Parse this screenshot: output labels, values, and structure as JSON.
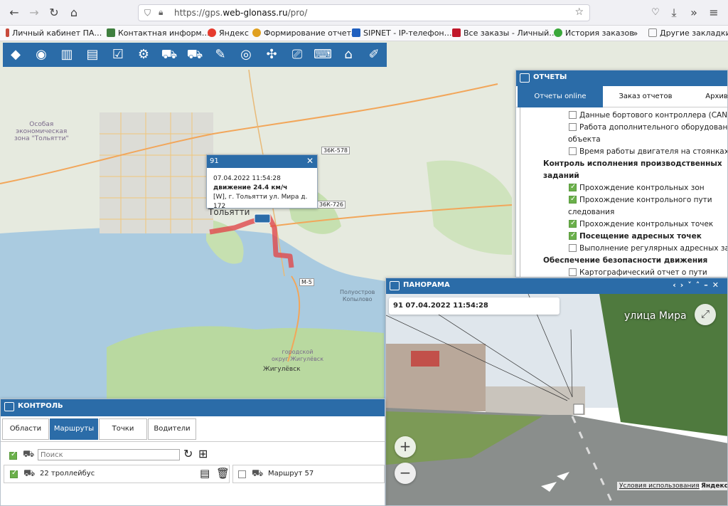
{
  "browser": {
    "url_prefix": "https://gps.",
    "url_domain": "web-glonass.ru",
    "url_path": "/pro/",
    "bookmarks": [
      {
        "label": "Личный кабинет ПА…",
        "color": "#c84b3c"
      },
      {
        "label": "Контактная информ…",
        "color": "#3f7f3f"
      },
      {
        "label": "Яндекс",
        "color": "#e63b2e"
      },
      {
        "label": "Формирование отчета",
        "color": "#e0a020"
      },
      {
        "label": "SIPNET - IP-телефон…",
        "color": "#1f5fbf"
      },
      {
        "label": "Все заказы - Личный…",
        "color": "#c0182a"
      },
      {
        "label": "История заказов",
        "color": "#3aa83a"
      },
      {
        "label": "Другие закладки",
        "color": "#888888"
      }
    ]
  },
  "map": {
    "labels": {
      "zone": [
        "Особая",
        "экономическая",
        "зона \"Тольятти\""
      ],
      "city": "Тольятти",
      "road1": "36К-578",
      "road2": "36К-726",
      "road3": "М-5",
      "village": [
        "Полуостров",
        "Копылово"
      ],
      "district": [
        "городской",
        "округ Жигулёвск"
      ],
      "town": "Жигулёвск"
    }
  },
  "popup": {
    "title": "91",
    "datetime": "07.04.2022 11:54:28",
    "status": "движение 24.4 км/ч",
    "address": "[W], г. Тольятти ул. Мира д. 172"
  },
  "reports": {
    "title": "ОТЧЕТЫ",
    "tabs": [
      "Отчеты online",
      "Заказ отчетов",
      "Архив"
    ],
    "items": [
      {
        "label": "Данные бортового контроллера (CAN)",
        "checked": false
      },
      {
        "label": "Работа дополнительного оборудования",
        "checked": false
      },
      {
        "label": "объекта",
        "continuation": true
      },
      {
        "label": "Время работы двигателя на стоянках",
        "checked": false
      },
      {
        "label": "Контроль исполнения производственных",
        "heading": true
      },
      {
        "label": "заданий",
        "heading": true
      },
      {
        "label": "Прохождение контрольных зон",
        "checked": true
      },
      {
        "label": "Прохождение контрольного пути",
        "checked": true
      },
      {
        "label": "следования",
        "continuation": true
      },
      {
        "label": "Прохождение контрольных точек",
        "checked": true
      },
      {
        "label": "Посещение адресных точек",
        "checked": true,
        "bold": true
      },
      {
        "label": "Выполнение регулярных адресных зад",
        "checked": false
      },
      {
        "label": "Обеспечение безопасности движения",
        "heading": true
      },
      {
        "label": "Картографический отчет о пути",
        "checked": false
      }
    ]
  },
  "panorama": {
    "title": "ПАНОРАМА",
    "caption": "91 07.04.2022 11:54:28",
    "street": "улица Мира",
    "terms": "Условия использования",
    "brand": "Яндекс"
  },
  "control": {
    "title": "КОНТРОЛЬ",
    "tabs": [
      "Области",
      "Маршруты",
      "Точки",
      "Водители"
    ],
    "search_placeholder": "Поиск",
    "routes": [
      "22 троллейбус",
      "Маршрут 57"
    ]
  },
  "colors": {
    "accent": "#2b6ca8",
    "route": "#e0484b",
    "water": "#aacbe0",
    "forest": "#b9d9a0",
    "check": "#6bb04b"
  }
}
